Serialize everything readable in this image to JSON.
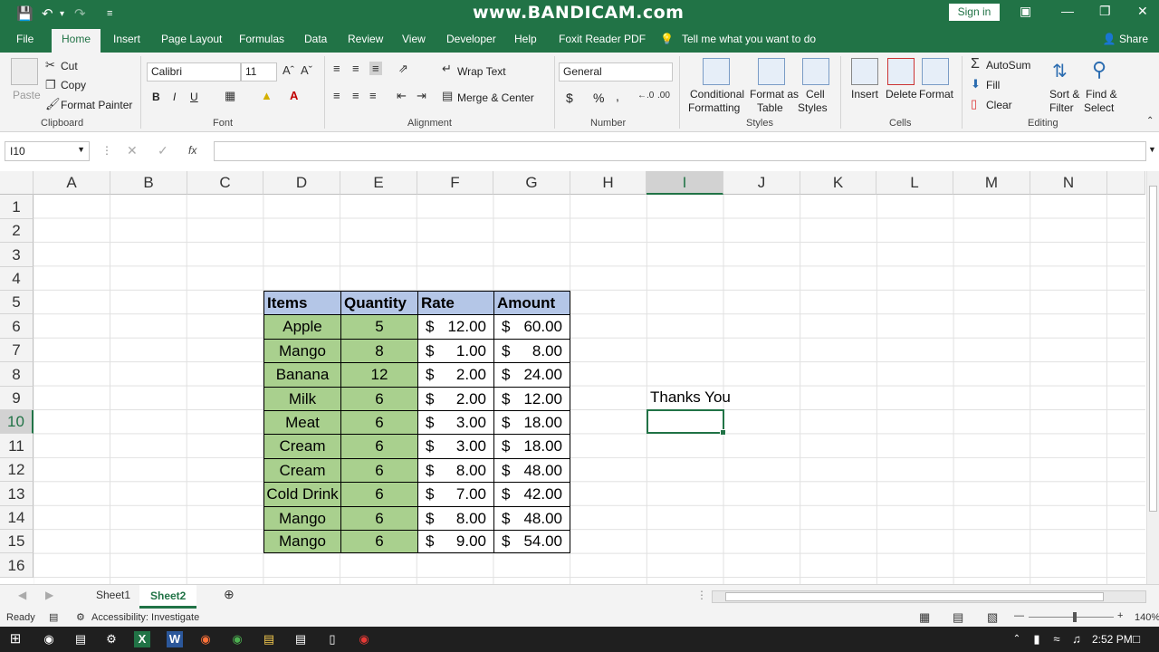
{
  "titlebar": {
    "watermark": "www.BANDICAM.com",
    "sign_in": "Sign in"
  },
  "tabs": [
    "File",
    "Home",
    "Insert",
    "Page Layout",
    "Formulas",
    "Data",
    "Review",
    "View",
    "Developer",
    "Help",
    "Foxit Reader PDF"
  ],
  "tell_me": "Tell me what you want to do",
  "share": "Share",
  "ribbon": {
    "clipboard": {
      "label": "Clipboard",
      "paste": "Paste",
      "cut": "Cut",
      "copy": "Copy",
      "format_painter": "Format Painter"
    },
    "font": {
      "label": "Font",
      "font_name": "Calibri",
      "font_size": "11",
      "bold": "B",
      "italic": "I",
      "underline": "U"
    },
    "alignment": {
      "label": "Alignment",
      "wrap_text": "Wrap Text",
      "merge_center": "Merge & Center"
    },
    "number": {
      "label": "Number",
      "format": "General",
      "currency": "$",
      "percent": "%",
      "comma": ","
    },
    "styles": {
      "label": "Styles",
      "conditional": "Conditional",
      "formatting": "Formatting",
      "format_as": "Format as",
      "table": "Table",
      "cell": "Cell",
      "cell_styles": "Styles"
    },
    "cells": {
      "label": "Cells",
      "insert": "Insert",
      "delete": "Delete",
      "format": "Format"
    },
    "editing": {
      "label": "Editing",
      "autosum": "AutoSum",
      "fill": "Fill",
      "clear": "Clear",
      "sort1": "Sort &",
      "sort2": "Filter",
      "find1": "Find &",
      "find2": "Select"
    }
  },
  "formula_bar": {
    "name_box": "I10",
    "fx": "fx",
    "value": ""
  },
  "columns": [
    "A",
    "B",
    "C",
    "D",
    "E",
    "F",
    "G",
    "H",
    "I",
    "J",
    "K",
    "L",
    "M",
    "N"
  ],
  "rows": [
    "1",
    "2",
    "3",
    "4",
    "5",
    "6",
    "7",
    "8",
    "9",
    "10",
    "11",
    "12",
    "13",
    "14",
    "15",
    "16"
  ],
  "selected": {
    "column": "I",
    "row": "10"
  },
  "table": {
    "headers": [
      "Items",
      "Quantity",
      "Rate",
      "Amount"
    ],
    "rows": [
      {
        "item": "Apple",
        "qty": "5",
        "rate": "12.00",
        "amount": "60.00"
      },
      {
        "item": "Mango",
        "qty": "8",
        "rate": "1.00",
        "amount": "8.00"
      },
      {
        "item": "Banana",
        "qty": "12",
        "rate": "2.00",
        "amount": "24.00"
      },
      {
        "item": "Milk",
        "qty": "6",
        "rate": "2.00",
        "amount": "12.00"
      },
      {
        "item": "Meat",
        "qty": "6",
        "rate": "3.00",
        "amount": "18.00"
      },
      {
        "item": "Cream",
        "qty": "6",
        "rate": "3.00",
        "amount": "18.00"
      },
      {
        "item": "Cream",
        "qty": "6",
        "rate": "8.00",
        "amount": "48.00"
      },
      {
        "item": "Cold Drink",
        "qty": "6",
        "rate": "7.00",
        "amount": "42.00"
      },
      {
        "item": "Mango",
        "qty": "6",
        "rate": "8.00",
        "amount": "48.00"
      },
      {
        "item": "Mango",
        "qty": "6",
        "rate": "9.00",
        "amount": "54.00"
      }
    ],
    "currency_symbol": "$"
  },
  "note_cell": "Thanks You",
  "sheets": [
    "Sheet1",
    "Sheet2"
  ],
  "active_sheet": "Sheet2",
  "status": {
    "ready": "Ready",
    "accessibility": "Accessibility: Investigate",
    "zoom": "140%"
  },
  "taskbar": {
    "time": "2:52 PM"
  },
  "colors": {
    "excel_green": "#217346",
    "header_fill": "#b4c6e7",
    "item_fill": "#a9d08e"
  }
}
